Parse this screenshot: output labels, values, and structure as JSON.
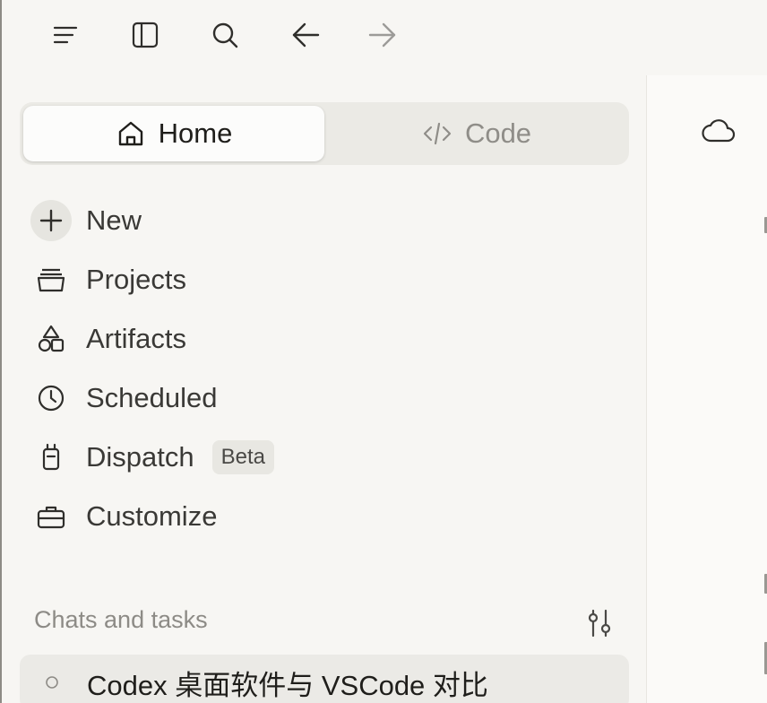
{
  "toolbar": {
    "icons": [
      "menu-icon",
      "sidebar-toggle-icon",
      "search-icon",
      "back-arrow-icon",
      "forward-arrow-icon"
    ]
  },
  "mode_tabs": {
    "home": {
      "label": "Home",
      "icon": "home-icon",
      "selected": true
    },
    "code": {
      "label": "Code",
      "icon": "code-icon",
      "selected": false
    }
  },
  "nav": {
    "new": {
      "label": "New",
      "icon": "plus-icon"
    },
    "projects": {
      "label": "Projects",
      "icon": "folder-icon"
    },
    "artifacts": {
      "label": "Artifacts",
      "icon": "shapes-icon"
    },
    "scheduled": {
      "label": "Scheduled",
      "icon": "clock-icon"
    },
    "dispatch": {
      "label": "Dispatch",
      "icon": "phone-icon",
      "badge": "Beta"
    },
    "customize": {
      "label": "Customize",
      "icon": "briefcase-icon"
    }
  },
  "chats": {
    "section_title": "Chats and tasks",
    "filter_icon": "filter-sliders-icon",
    "items": [
      {
        "title": "Codex 桌面软件与 VSCode 对比",
        "status_icon": "status-circle-icon"
      }
    ]
  },
  "main_pane": {
    "icon": "cloud-icon"
  },
  "colors": {
    "background": "#f7f6f3",
    "segment_bg": "#ebeae5",
    "selected_tab": "#fcfcfb",
    "text": "#2f2e2b",
    "muted": "#8d8b86"
  }
}
